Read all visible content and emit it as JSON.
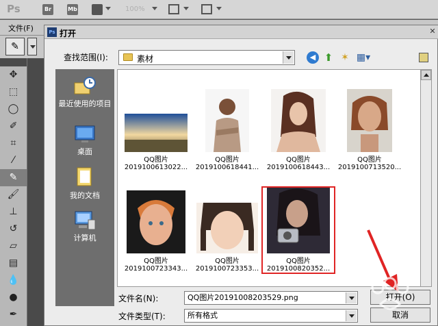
{
  "app": {
    "logo": "Ps",
    "bridge_label": "Br",
    "minibridge_label": "Mb",
    "zoom": "100%",
    "file_menu": "文件(F)"
  },
  "dialog": {
    "title": "打开",
    "lookin_label": "查找范围(I):",
    "lookin_value": "素材",
    "places": [
      {
        "label": "最近使用的项目",
        "icon": "recent-icon"
      },
      {
        "label": "桌面",
        "icon": "desktop-icon"
      },
      {
        "label": "我的文档",
        "icon": "documents-icon"
      },
      {
        "label": "计算机",
        "icon": "computer-icon"
      }
    ],
    "files": [
      {
        "name": "QQ图片",
        "date": "2019100613022...",
        "thumb": "landscape"
      },
      {
        "name": "QQ图片",
        "date": "2019100618441...",
        "thumb": "man"
      },
      {
        "name": "QQ图片",
        "date": "2019100618443...",
        "thumb": "woman"
      },
      {
        "name": "QQ图片",
        "date": "2019100713520...",
        "thumb": "face"
      },
      {
        "name": "QQ图片",
        "date": "2019100723343...",
        "thumb": "boy"
      },
      {
        "name": "QQ图片",
        "date": "2019100723353...",
        "thumb": "girl"
      },
      {
        "name": "QQ图片",
        "date": "2019100820352...",
        "thumb": "camera-girl",
        "selected": true
      }
    ],
    "filename_label": "文件名(N):",
    "filename_value": "QQ图片20191008203529.png",
    "filetype_label": "文件类型(T):",
    "filetype_value": "所有格式",
    "open_button": "打开(O)",
    "cancel_button": "取消"
  },
  "colors": {
    "selection_outline": "#e02424",
    "annotation_arrow": "#e02424"
  }
}
